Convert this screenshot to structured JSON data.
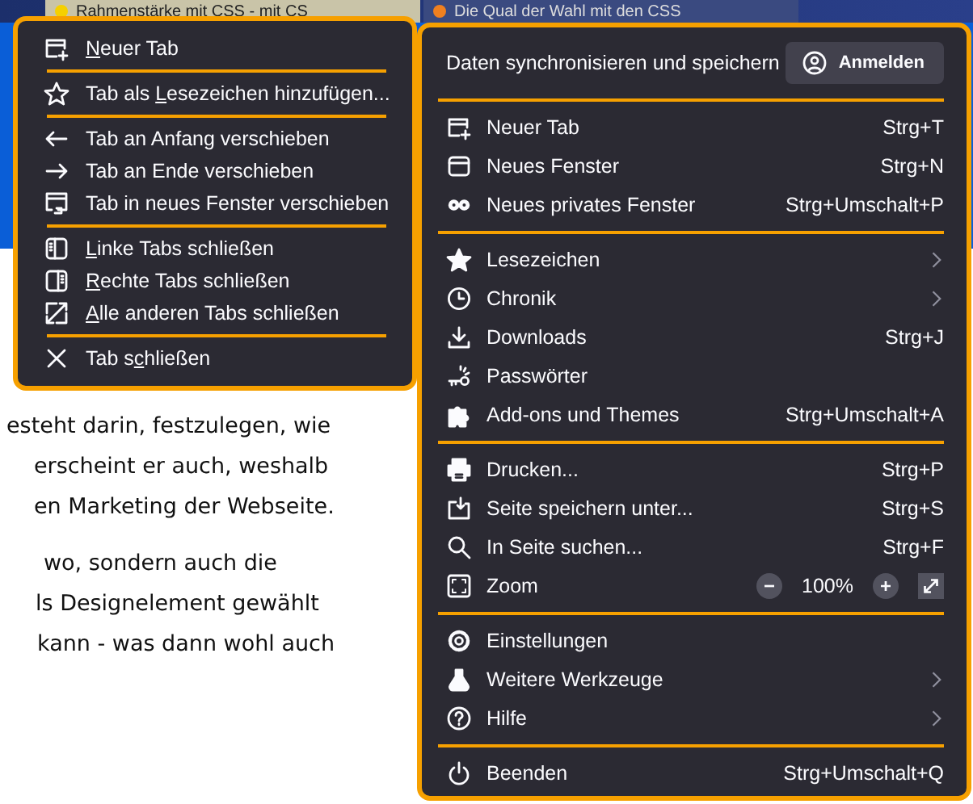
{
  "tabs": [
    {
      "title": "Rahmenstärke mit CSS - mit CS",
      "selected": true,
      "color": "#f5d000"
    },
    {
      "title": "Die Qual der Wahl mit den CSS",
      "selected": false,
      "color": "#f08020"
    }
  ],
  "page": {
    "paragraphs": [
      [
        "esteht darin, festzulegen, wie",
        "erscheint er auch, weshalb",
        "en Marketing der Webseite."
      ],
      [
        "wo, sondern auch die",
        "ls Designelement gewählt",
        "kann - was dann wohl auch"
      ]
    ]
  },
  "tab_context_menu": {
    "items": [
      {
        "kind": "item",
        "key": "N",
        "post": "euer Tab"
      },
      {
        "kind": "separator"
      },
      {
        "kind": "item",
        "pre": "Tab als ",
        "key": "L",
        "post": "esezeichen hinzufügen..."
      },
      {
        "kind": "separator"
      },
      {
        "kind": "item",
        "pre": "Tab an Anfang verschieben"
      },
      {
        "kind": "item",
        "pre": "Tab an Ende verschieben"
      },
      {
        "kind": "item",
        "pre": "Tab in neues Fenster verschieben"
      },
      {
        "kind": "separator"
      },
      {
        "kind": "item",
        "key": "L",
        "post": "inke Tabs schließen"
      },
      {
        "kind": "item",
        "key": "R",
        "post": "echte Tabs schließen"
      },
      {
        "kind": "item",
        "key": "A",
        "post": "lle anderen Tabs schließen"
      },
      {
        "kind": "separator"
      },
      {
        "kind": "item",
        "pre": "Tab s",
        "key": "c",
        "post": "hließen"
      }
    ]
  },
  "app_menu": {
    "header": {
      "title": "Daten synchronisieren und speichern",
      "button": "Anmelden"
    },
    "items": [
      {
        "kind": "separator"
      },
      {
        "kind": "item",
        "label": "Neuer Tab",
        "shortcut": "Strg+T",
        "submenu": false
      },
      {
        "kind": "item",
        "label": "Neues Fenster",
        "shortcut": "Strg+N",
        "submenu": false
      },
      {
        "kind": "item",
        "label": "Neues privates Fenster",
        "shortcut": "Strg+Umschalt+P",
        "submenu": false
      },
      {
        "kind": "separator"
      },
      {
        "kind": "item",
        "label": "Lesezeichen",
        "submenu": true
      },
      {
        "kind": "item",
        "label": "Chronik",
        "submenu": true
      },
      {
        "kind": "item",
        "label": "Downloads",
        "shortcut": "Strg+J",
        "submenu": false
      },
      {
        "kind": "item",
        "label": "Passwörter",
        "submenu": false
      },
      {
        "kind": "item",
        "label": "Add-ons und Themes",
        "shortcut": "Strg+Umschalt+A",
        "submenu": false
      },
      {
        "kind": "separator"
      },
      {
        "kind": "item",
        "label": "Drucken...",
        "shortcut": "Strg+P",
        "submenu": false
      },
      {
        "kind": "item",
        "label": "Seite speichern unter...",
        "shortcut": "Strg+S",
        "submenu": false
      },
      {
        "kind": "item",
        "label": "In Seite suchen...",
        "shortcut": "Strg+F",
        "submenu": false
      },
      {
        "kind": "zoom",
        "label": "Zoom",
        "value": "100%"
      },
      {
        "kind": "separator"
      },
      {
        "kind": "item",
        "label": "Einstellungen",
        "submenu": false
      },
      {
        "kind": "item",
        "label": "Weitere Werkzeuge",
        "submenu": true
      },
      {
        "kind": "item",
        "label": "Hilfe",
        "submenu": true
      },
      {
        "kind": "separator"
      },
      {
        "kind": "item",
        "label": "Beenden",
        "shortcut": "Strg+Umschalt+Q",
        "submenu": false
      }
    ]
  }
}
